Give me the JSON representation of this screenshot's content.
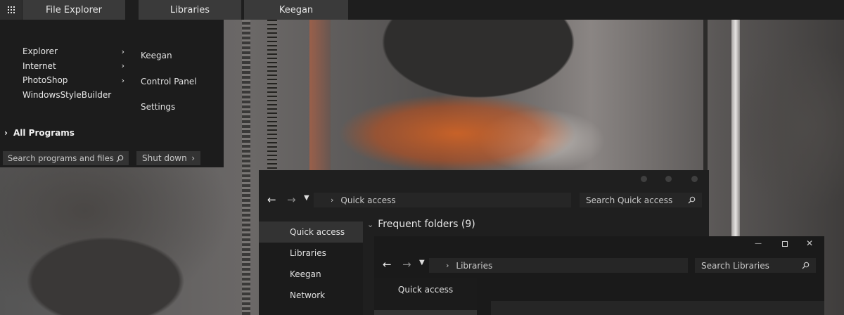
{
  "taskbar": {
    "start_icon": "grid-icon",
    "tabs": [
      "File Explorer",
      "Libraries",
      "Keegan"
    ]
  },
  "start_menu": {
    "programs": [
      {
        "label": "Explorer",
        "has_submenu": true
      },
      {
        "label": "Internet",
        "has_submenu": true
      },
      {
        "label": "PhotoShop",
        "has_submenu": true
      },
      {
        "label": "WindowsStyleBuilder",
        "has_submenu": false
      }
    ],
    "user_links": [
      "Keegan",
      "Control Panel",
      "Settings"
    ],
    "all_programs": "All Programs",
    "search_placeholder": "Search programs and files",
    "shutdown_label": "Shut down"
  },
  "explorer_quick": {
    "address": "Quick access",
    "search_placeholder": "Search Quick access",
    "sidebar": [
      "Quick access",
      "Libraries",
      "Keegan",
      "Network"
    ],
    "active_item": "Quick access",
    "section_title": "Frequent folders (9)"
  },
  "explorer_libraries": {
    "address": "Libraries",
    "search_placeholder": "Search Libraries",
    "sidebar": [
      "Quick access"
    ]
  },
  "colors": {
    "panel": "#1f1f1f",
    "taskbar": "#1e1e1e",
    "tab": "#3a3a3a",
    "accent_orange": "#cd6226"
  }
}
